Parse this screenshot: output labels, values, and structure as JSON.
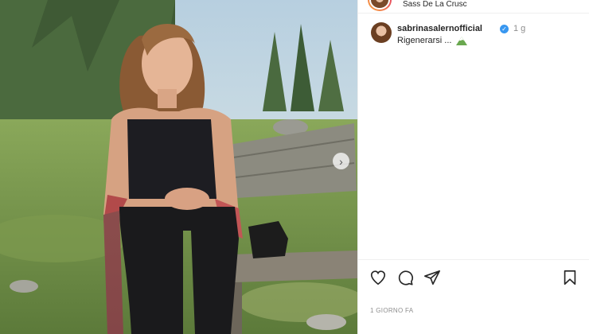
{
  "post": {
    "location": "Sass De La Crusc",
    "username": "sabrinasalernofficial",
    "time_ago": "1 g",
    "caption": "Rigenerarsi ...",
    "caption_icon": "mountain-emoji-icon",
    "date_label": "1 GIORNO FA"
  },
  "actions": {
    "icons": [
      "heart-icon",
      "comment-icon",
      "share-icon",
      "bookmark-icon"
    ]
  },
  "colors": {
    "verified": "#3897f0",
    "text": "#262626",
    "muted": "#8e8e8e"
  }
}
